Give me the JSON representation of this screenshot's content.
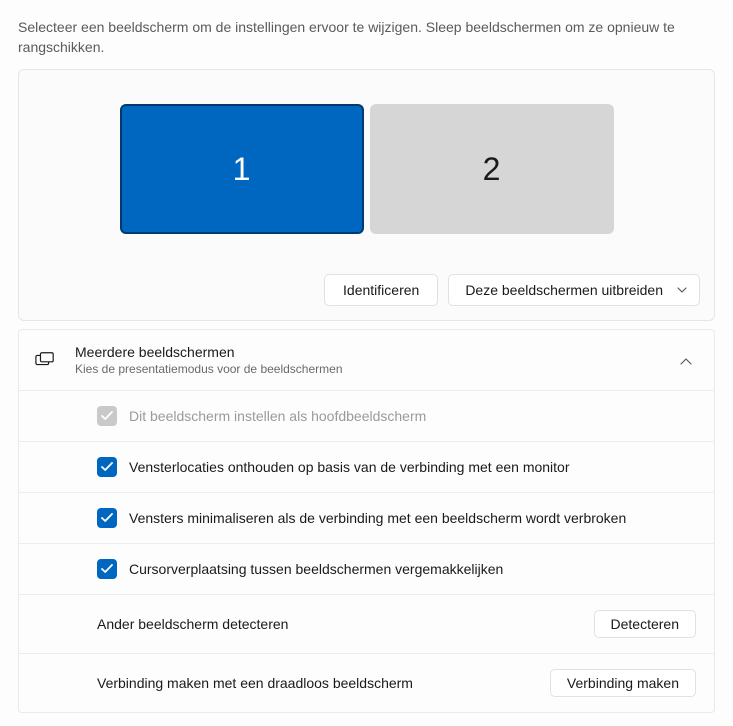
{
  "instructions": "Selecteer een beeldscherm om de instellingen ervoor te wijzigen. Sleep beeldschermen om ze opnieuw te rangschikken.",
  "monitors": {
    "primary": "1",
    "secondary": "2"
  },
  "actions": {
    "identify": "Identificeren",
    "mode_dropdown": "Deze beeldschermen uitbreiden"
  },
  "multi": {
    "title": "Meerdere beeldschermen",
    "subtitle": "Kies de presentatiemodus voor de beeldschermen"
  },
  "options": {
    "make_main": "Dit beeldscherm instellen als hoofdbeeldscherm",
    "remember_locations": "Vensterlocaties onthouden op basis van de verbinding met een monitor",
    "minimize_windows": "Vensters minimaliseren als de verbinding met een beeldscherm wordt verbroken",
    "ease_cursor": "Cursorverplaatsing tussen beeldschermen vergemakkelijken"
  },
  "detect": {
    "label": "Ander beeldscherm detecteren",
    "button": "Detecteren"
  },
  "wireless": {
    "label": "Verbinding maken met een draadloos beeldscherm",
    "button": "Verbinding maken"
  }
}
